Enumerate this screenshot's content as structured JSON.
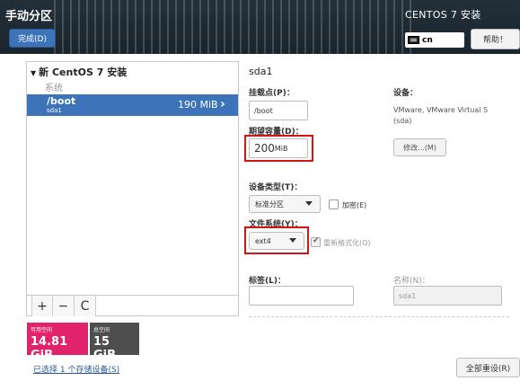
{
  "header": {
    "title": "手动分区",
    "done_label": "完成(D)",
    "product": "CENTOS 7 安装",
    "keyboard_layout": "cn",
    "help_label": "帮助！"
  },
  "tree": {
    "root_label": "新 CentOS 7 安装",
    "group_label": "系统",
    "partitions": [
      {
        "mount": "/boot",
        "device": "sda1",
        "size": "190 MiB"
      }
    ]
  },
  "toolbar": {
    "add": "+",
    "remove": "−",
    "refresh": "C"
  },
  "space": {
    "available_label": "可用空间",
    "available_value": "14.81 GiB",
    "total_label": "总空间",
    "total_value": "15 GiB"
  },
  "footer": {
    "selected_devices": "已选择 1 个存储设备(S)",
    "reset_label": "全部重设(R)"
  },
  "details": {
    "title": "sda1",
    "mount_label": "挂载点(P)：",
    "mount_value": "/boot",
    "capacity_label": "期望容量(D)：",
    "capacity_number": "200",
    "capacity_unit": "MiB",
    "device_label": "设备：",
    "device_desc": "VMware, VMware Virtual S",
    "device_sub": "(sda)",
    "modify_label": "修改...(M)",
    "device_type_label": "设备类型(T)：",
    "device_type_value": "标准分区",
    "encrypt_label": "加密(E)",
    "fs_label": "文件系统(Y)：",
    "fs_value": "ext4",
    "reformat_label": "重新格式化(O)",
    "tag_label": "标签(L)：",
    "tag_value": "",
    "name_label": "名称(N)：",
    "name_value": "sda1"
  }
}
